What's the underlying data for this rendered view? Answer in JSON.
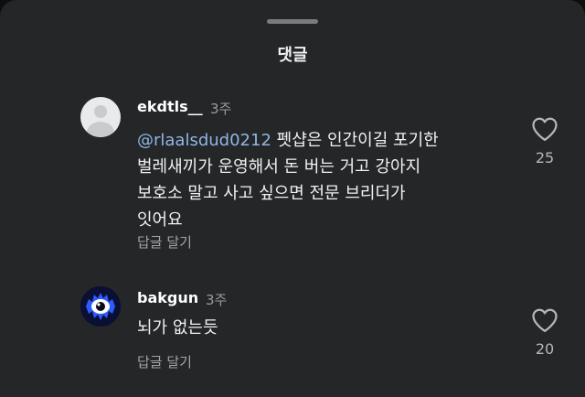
{
  "sheet": {
    "title": "댓글"
  },
  "comments": [
    {
      "username": "ekdtls__",
      "time": "3주",
      "mention": "@rlaalsdud0212",
      "lines": [
        " 펫샵은 인간이길 포기한",
        "벌레새끼가 운영해서 돈 버는 거고 강아지",
        "보호소 말고 사고 싶으면 전문 브리더가",
        "잇어요"
      ],
      "reply_label": "답글 달기",
      "like_count": "25",
      "avatar_icon": "default-profile-icon"
    },
    {
      "username": "bakgun",
      "time": "3주",
      "text": "뇌가 없는듯",
      "reply_label": "답글 달기",
      "like_count": "20",
      "avatar_icon": "blue-eye-avatar"
    }
  ],
  "colors": {
    "background": "#252628",
    "mention": "#8fb7e6",
    "text": "#f1f1f1",
    "muted": "#9b9c9e"
  }
}
